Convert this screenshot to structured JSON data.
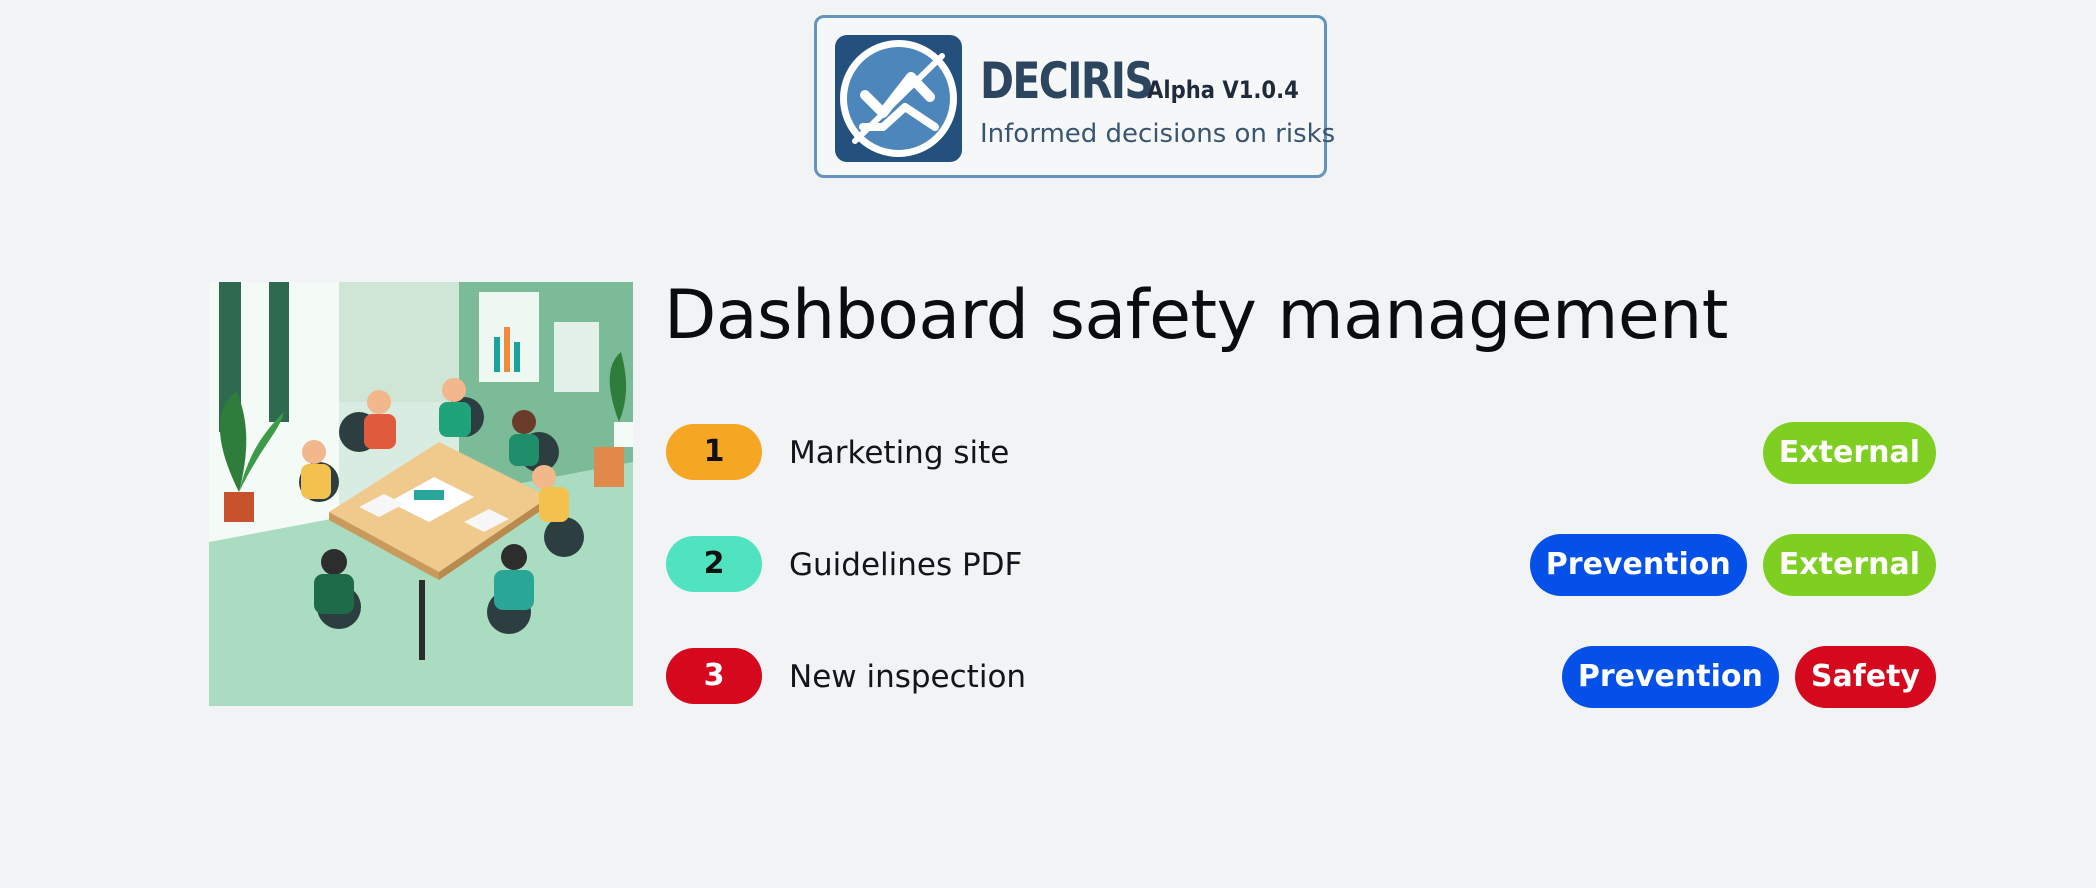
{
  "header": {
    "brand_name": "DECIRIS",
    "version": "Alpha V1.0.4",
    "tagline": "Informed decisions on risks"
  },
  "main": {
    "title": "Dashboard safety management",
    "items": [
      {
        "number": "1",
        "label": "Marketing site",
        "num_bg": "#f5a623",
        "num_color": "#111111",
        "tags": [
          {
            "label": "External",
            "color": "#7ecf22"
          }
        ]
      },
      {
        "number": "2",
        "label": "Guidelines PDF",
        "num_bg": "#4fe3c0",
        "num_color": "#111111",
        "tags": [
          {
            "label": "Prevention",
            "color": "#0550e8"
          },
          {
            "label": "External",
            "color": "#7ecf22"
          }
        ]
      },
      {
        "number": "3",
        "label": "New inspection",
        "num_bg": "#d6081e",
        "num_color": "#ffffff",
        "tags": [
          {
            "label": "Prevention",
            "color": "#0550e8"
          },
          {
            "label": "Safety",
            "color": "#d6081e"
          }
        ]
      }
    ]
  },
  "colors": {
    "background": "#f2f3f5",
    "logo_border": "#6393be",
    "logo_tile": "#24507d"
  },
  "icons": {
    "logo": "checkmark-wave-logo-icon",
    "hero": "team-meeting-illustration"
  }
}
